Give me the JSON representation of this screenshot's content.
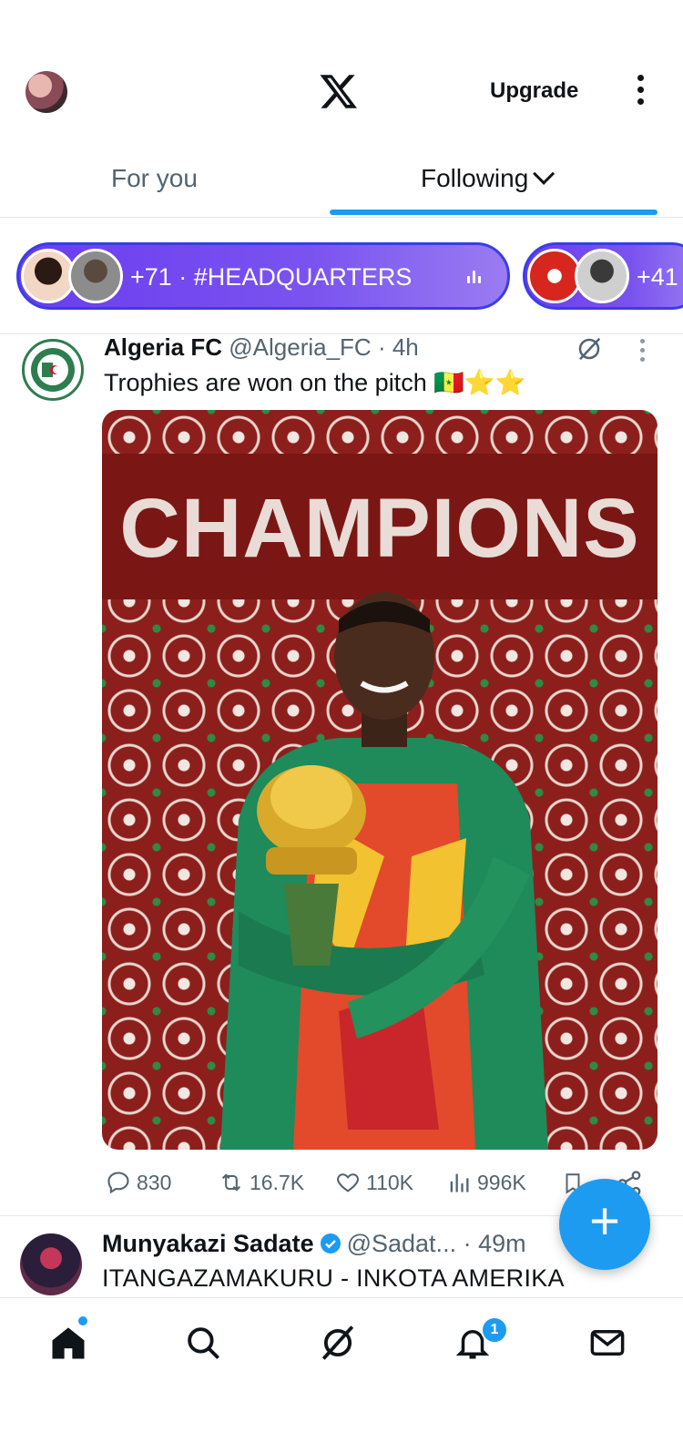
{
  "header": {
    "upgrade_label": "Upgrade"
  },
  "tabs": {
    "for_you": "For you",
    "following": "Following"
  },
  "spaces": [
    {
      "label": "+71 · #HEADQUARTERS"
    },
    {
      "label": "+41"
    }
  ],
  "tweet1": {
    "name": "Algeria FC",
    "handle": "@Algeria_FC",
    "time": "· 4h",
    "text": "Trophies are won on the pitch 🇸🇳⭐⭐",
    "media_title": "CHAMPIONS",
    "replies": "830",
    "retweets": "16.7K",
    "likes": "110K",
    "views": "996K"
  },
  "tweet2": {
    "name": "Munyakazi Sadate",
    "handle": "@Sadat...",
    "time": "· 49m",
    "text": "ITANGAZAMAKURU - INKOTA AMERIKA"
  },
  "nav": {
    "notif_badge": "1"
  },
  "colors": {
    "accent": "#1d9bf0",
    "spaces_pill": "#6b3df0",
    "text_primary": "#0f1419",
    "text_secondary": "#536471"
  }
}
